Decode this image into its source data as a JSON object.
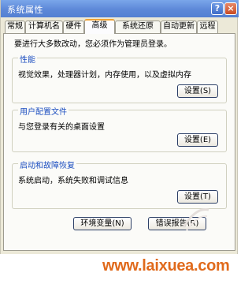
{
  "window": {
    "title": "系统属性",
    "help_glyph": "?",
    "close_glyph": "×"
  },
  "tabs": [
    {
      "label": "常规",
      "active": false
    },
    {
      "label": "计算机名",
      "active": false
    },
    {
      "label": "硬件",
      "active": false
    },
    {
      "label": "高级",
      "active": true
    },
    {
      "label": "系统还原",
      "active": false
    },
    {
      "label": "自动更新",
      "active": false
    },
    {
      "label": "远程",
      "active": false
    }
  ],
  "panel": {
    "notice": "要进行大多数改动，您必须作为管理员登录。",
    "groups": [
      {
        "title": "性能",
        "description": "视觉效果，处理器计划，内存使用，以及虚拟内存",
        "button": "设置(S)"
      },
      {
        "title": "用户配置文件",
        "description": "与您登录有关的桌面设置",
        "button": "设置(E)"
      },
      {
        "title": "启动和故障恢复",
        "description": "系统启动，系统失败和调试信息",
        "button": "设置(T)"
      }
    ],
    "env_button": "环境变量(N)",
    "error_button": "错误报告(R)"
  },
  "watermark": {
    "text": "www.laixuea.com"
  },
  "colors": {
    "accent_tab": "#f0a232",
    "group_title": "#1d4fc0",
    "watermark": "#e06a1c"
  }
}
